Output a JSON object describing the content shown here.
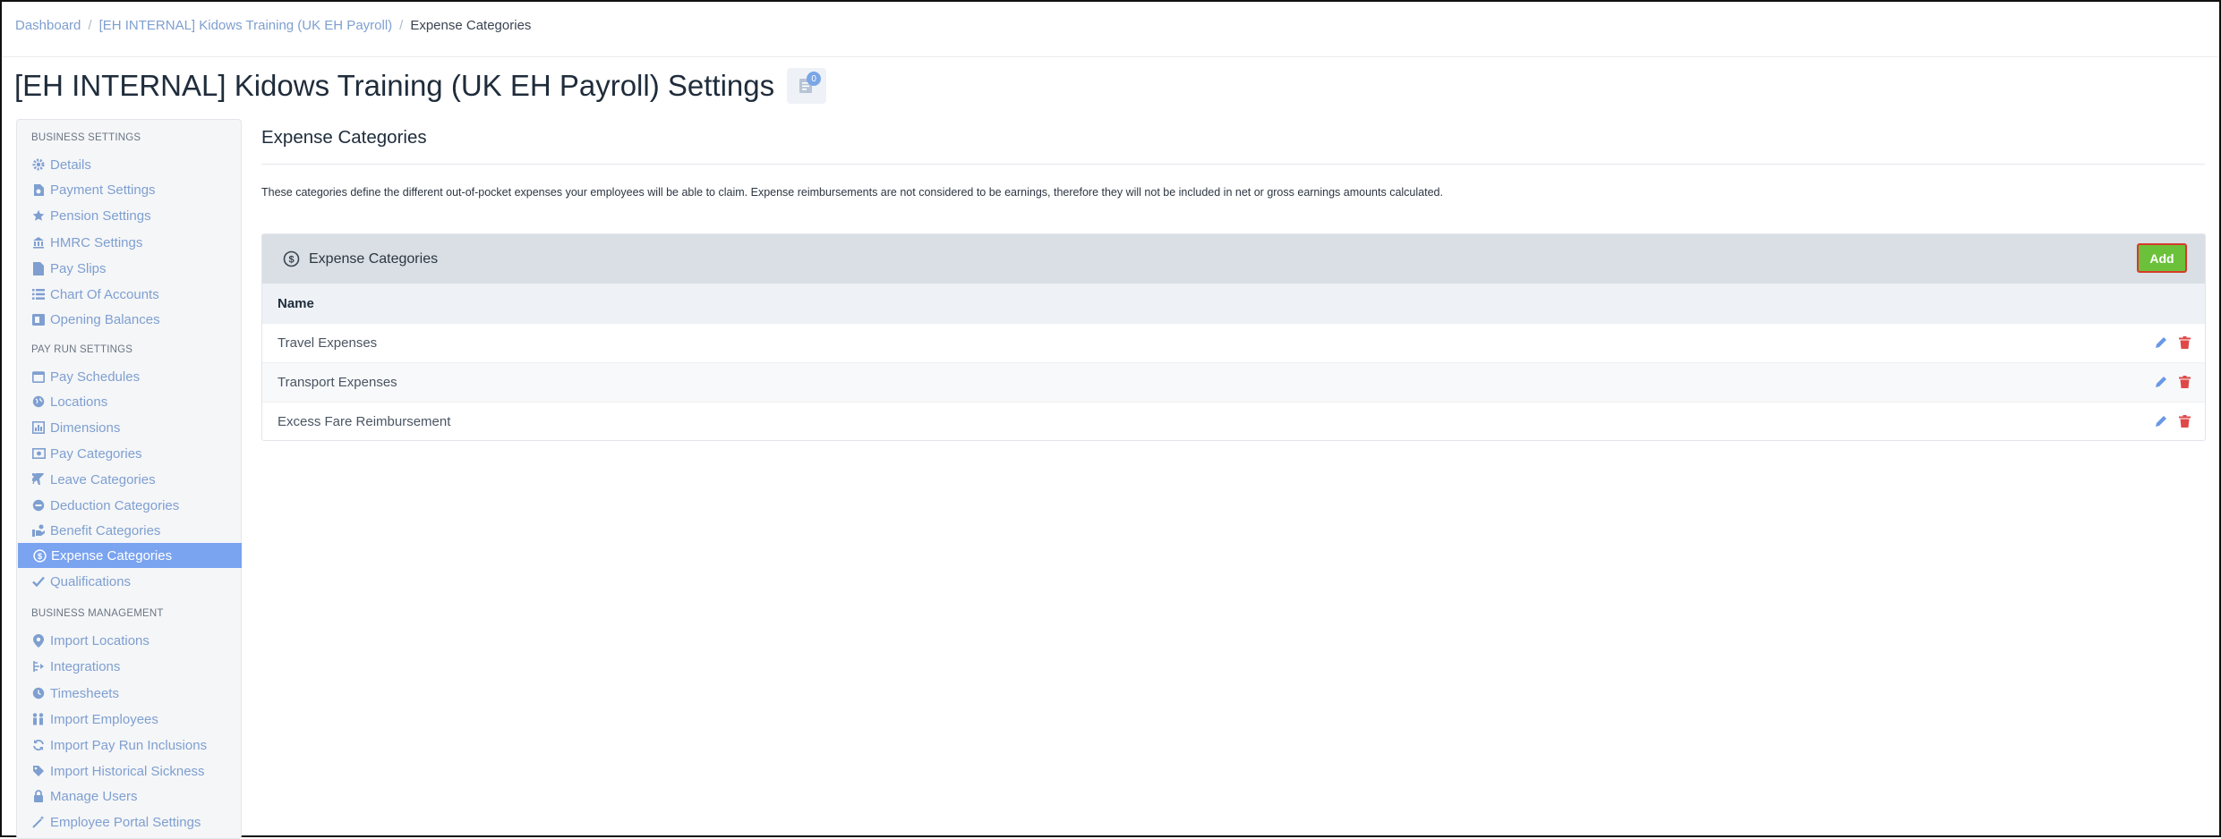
{
  "breadcrumb": {
    "items": [
      "Dashboard",
      "[EH INTERNAL] Kidows Training (UK EH Payroll)",
      "Expense Categories"
    ],
    "separator": "/"
  },
  "page": {
    "title": "[EH INTERNAL] Kidows Training (UK EH Payroll) Settings",
    "title_icon": "notes-icon",
    "badge_count": "0"
  },
  "sidebar": {
    "sections": [
      {
        "heading": "BUSINESS SETTINGS",
        "items": [
          {
            "label": "Details",
            "icon": "gear-icon"
          },
          {
            "label": "Payment Settings",
            "icon": "payment-doc-icon"
          },
          {
            "label": "Pension Settings",
            "icon": "star-icon"
          },
          {
            "label": "HMRC Settings",
            "icon": "building-icon"
          },
          {
            "label": "Pay Slips",
            "icon": "file-icon"
          },
          {
            "label": "Chart Of Accounts",
            "icon": "list-icon"
          },
          {
            "label": "Opening Balances",
            "icon": "ledger-icon"
          }
        ]
      },
      {
        "heading": "PAY RUN SETTINGS",
        "items": [
          {
            "label": "Pay Schedules",
            "icon": "calendar-icon"
          },
          {
            "label": "Locations",
            "icon": "globe-icon"
          },
          {
            "label": "Dimensions",
            "icon": "chart-icon"
          },
          {
            "label": "Pay Categories",
            "icon": "money-icon"
          },
          {
            "label": "Leave Categories",
            "icon": "plane-icon"
          },
          {
            "label": "Deduction Categories",
            "icon": "minus-circle-icon"
          },
          {
            "label": "Benefit Categories",
            "icon": "benefit-icon"
          },
          {
            "label": "Expense Categories",
            "icon": "expense-icon",
            "active": true
          },
          {
            "label": "Qualifications",
            "icon": "check-icon"
          }
        ]
      },
      {
        "heading": "BUSINESS MANAGEMENT",
        "items": [
          {
            "label": "Import Locations",
            "icon": "map-pin-icon"
          },
          {
            "label": "Integrations",
            "icon": "integration-icon"
          },
          {
            "label": "Timesheets",
            "icon": "clock-icon"
          },
          {
            "label": "Import Employees",
            "icon": "people-icon"
          },
          {
            "label": "Import Pay Run Inclusions",
            "icon": "refresh-icon"
          },
          {
            "label": "Import Historical Sickness",
            "icon": "tag-icon"
          },
          {
            "label": "Manage Users",
            "icon": "lock-icon"
          },
          {
            "label": "Employee Portal Settings",
            "icon": "wand-icon"
          }
        ]
      }
    ]
  },
  "main": {
    "title": "Expense Categories",
    "description": "These categories define the different out-of-pocket expenses your employees will be able to claim. Expense reimbursements are not considered to be earnings, therefore they will not be included in net or gross earnings amounts calculated.",
    "panel": {
      "title": "Expense Categories",
      "icon": "expense-icon",
      "add_label": "Add",
      "column_header": "Name",
      "rows": [
        {
          "name": "Travel Expenses"
        },
        {
          "name": "Transport Expenses"
        },
        {
          "name": "Excess Fare Reimbursement"
        }
      ]
    }
  },
  "colors": {
    "link": "#7e9fd0",
    "active_bg": "#7aa3f0",
    "add_button": "#6cc13a",
    "add_border": "#d63a2a",
    "delete_icon": "#e04848",
    "edit_icon": "#6a98e8"
  }
}
